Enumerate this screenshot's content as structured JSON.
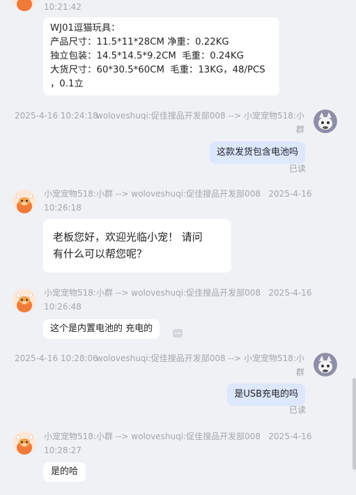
{
  "messages": [
    {
      "time": "10:21:42",
      "lines": [
        "WJ01逗猫玩具：",
        "产品尺寸：11.5*11*28CM 净重：0.22KG",
        "独立包装：14.5*14.5*9.2CM  毛重：0.24KG",
        "大货尺寸：60*30.5*60CM  毛重：13KG，48/PCS",
        "，0.1立"
      ]
    },
    {
      "header_time": "2025-4-16 10:24:18",
      "header_route_line1": "woloveshuqi:促佳搜品开发部008 --> 小宠宠物518:小",
      "header_route_line2": "群",
      "text": "这款发货包含电池吗",
      "status": "已读"
    },
    {
      "header_line1": "小宠宠物518:小群 --> woloveshuqi:促佳搜品开发部008   2025-4-16",
      "header_line2": "10:26:18",
      "line1": "老板您好，欢迎光临小宠！ 请问",
      "line2": "有什么可以帮您呢？"
    },
    {
      "header_line1": "小宠宠物518:小群 --> woloveshuqi:促佳搜品开发部008   2025-4-16",
      "header_line2": "10:26:48",
      "text": "这个是内置电池的 充电的"
    },
    {
      "header_time": "2025-4-16 10:28:06",
      "header_route_line1": "woloveshuqi:促佳搜品开发部008 --> 小宠宠物518:小",
      "header_route_line2": "群",
      "text": "是USB充电的吗",
      "status": "已读"
    },
    {
      "header_line1": "小宠宠物518:小群 --> woloveshuqi:促佳搜品开发部008   2025-4-16",
      "header_line2": "10:28:27",
      "text": "是的哈"
    }
  ],
  "icons": {
    "agent_avatar": "cartoon-bull-avatar-icon",
    "user_avatar": "cat-avatar-icon",
    "more_options": "more-options-icon"
  },
  "colors": {
    "background": "#f0f1f5",
    "incoming_bubble": "#ffffff",
    "outgoing_bubble": "#dde7ff",
    "meta_text": "#a2a5ab"
  }
}
